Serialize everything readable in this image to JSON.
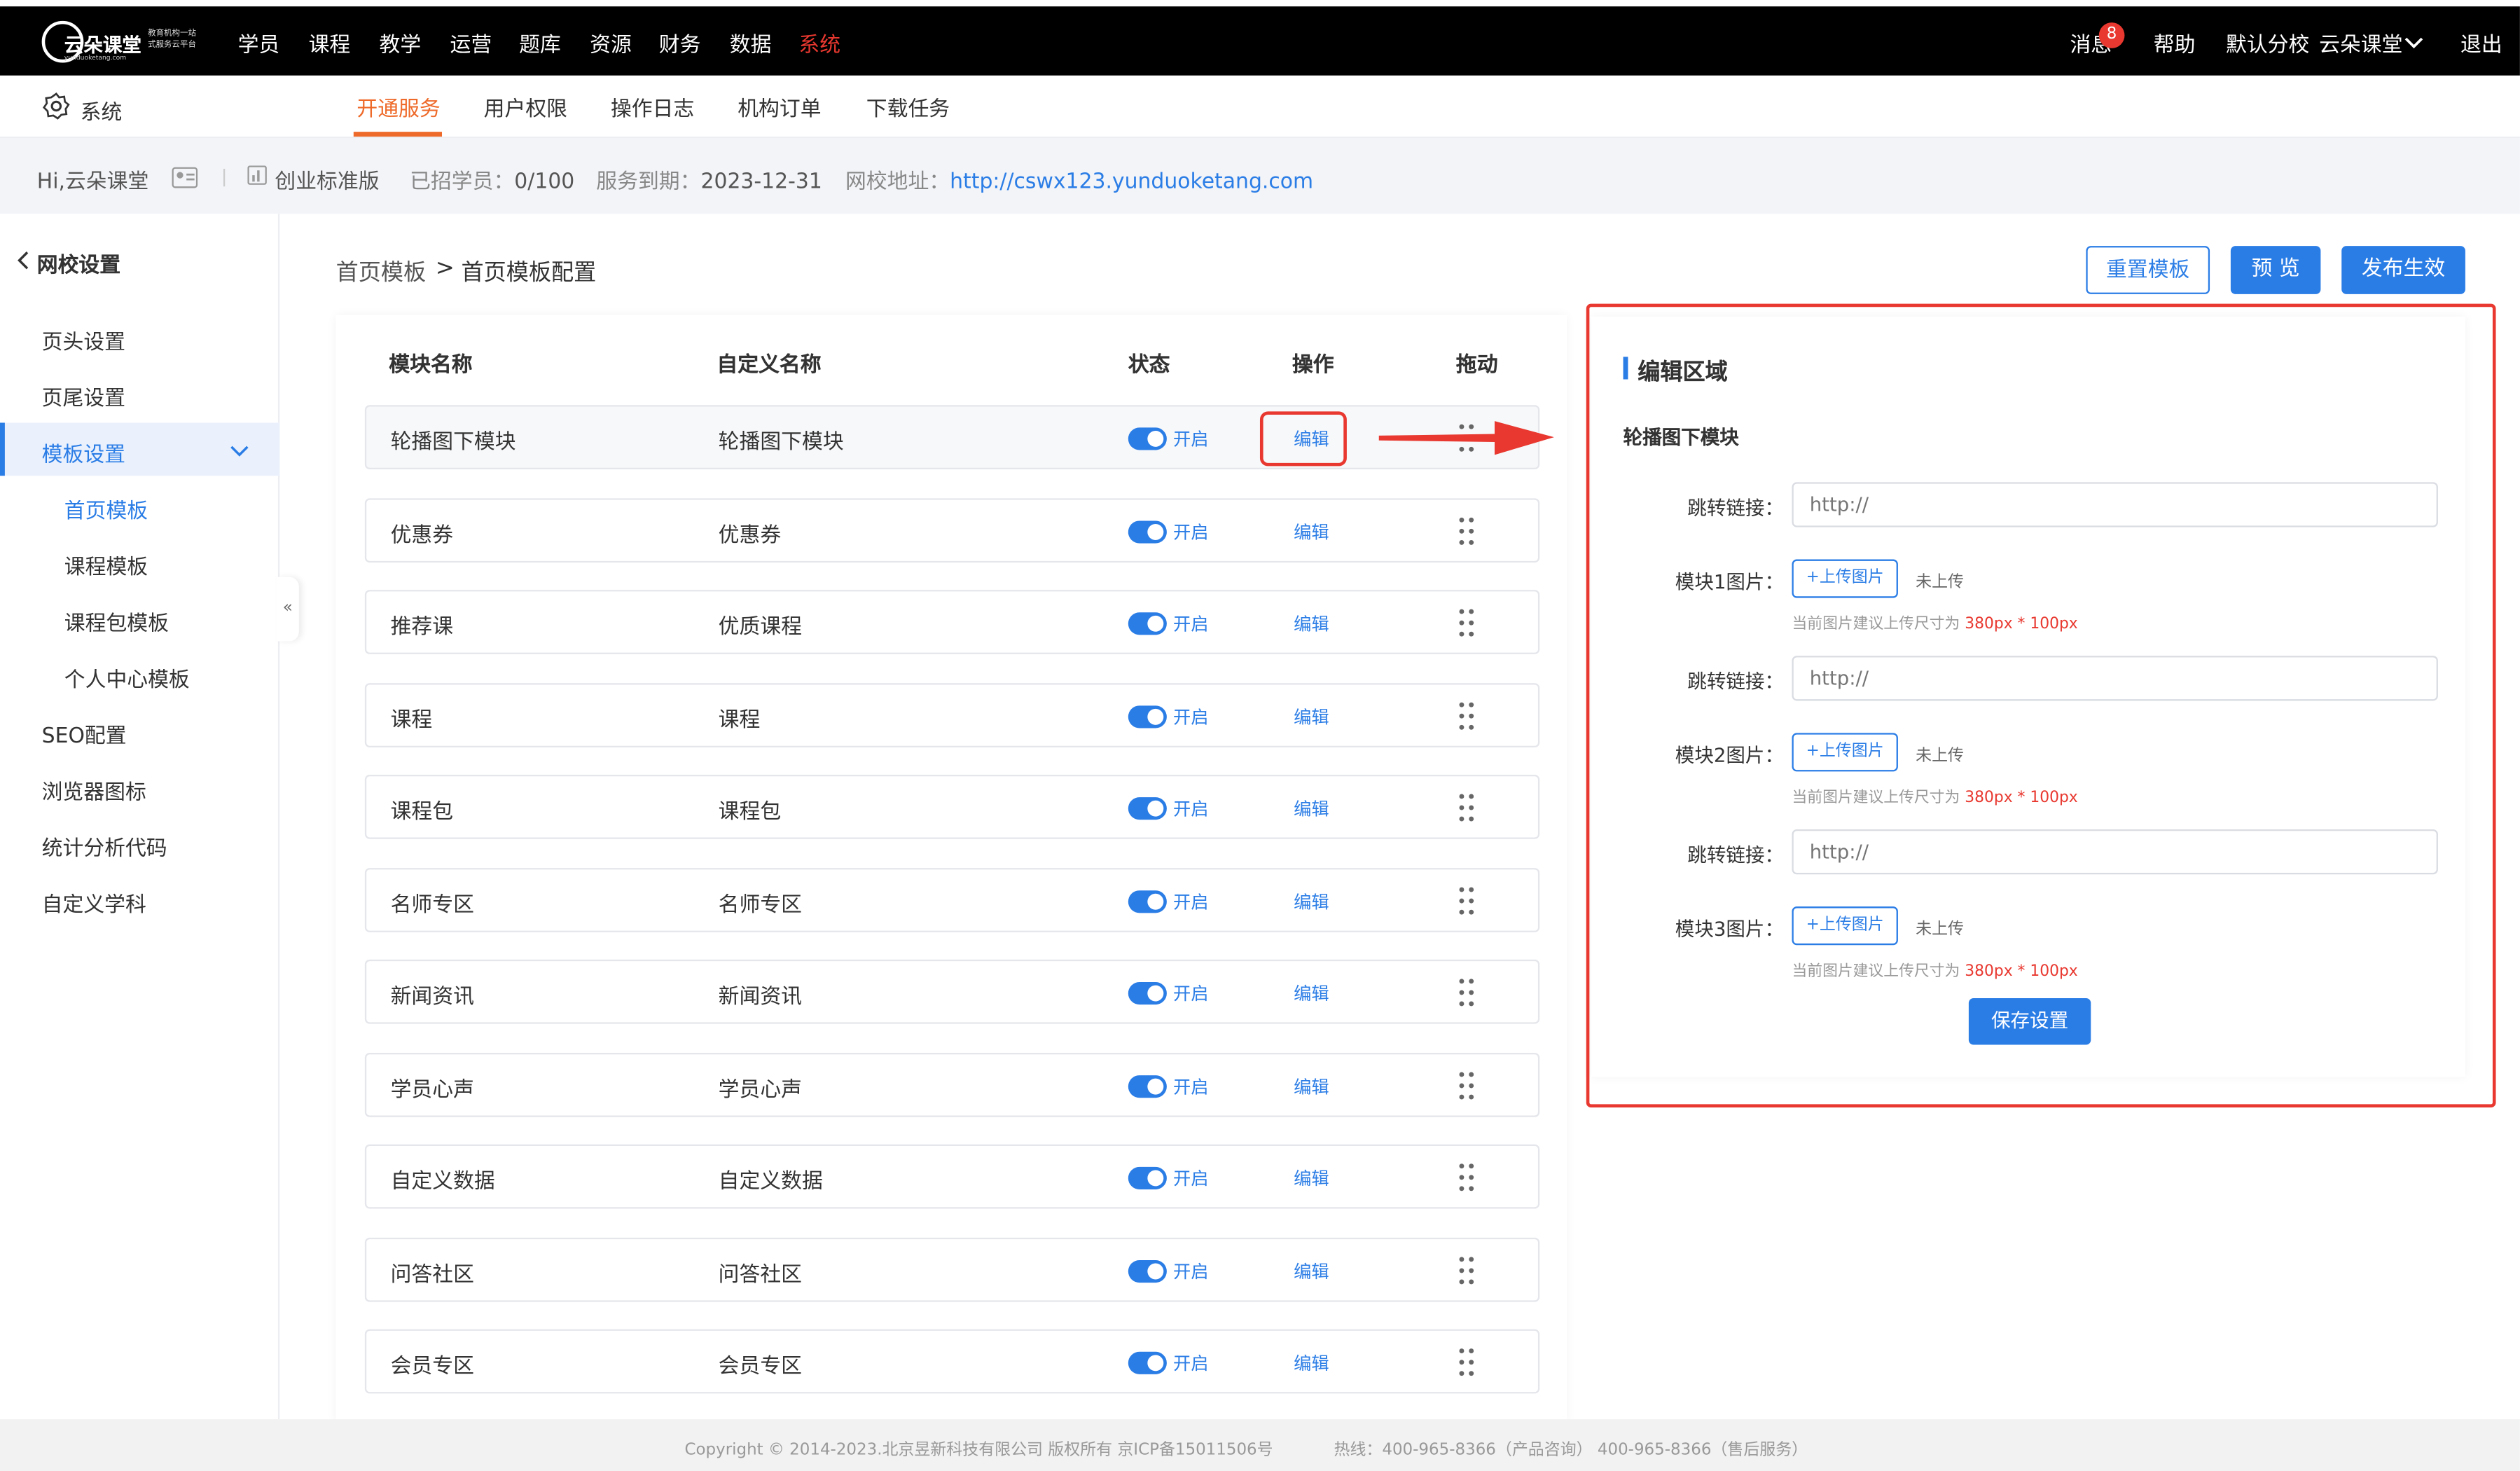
{
  "topnav": {
    "logo_text": "云朵课堂",
    "logo_sub_1": "教育机构一站",
    "logo_sub_2": "式服务云平台",
    "logo_url": "yunduoketang.com",
    "items": [
      "学员",
      "课程",
      "教学",
      "运营",
      "题库",
      "资源",
      "财务",
      "数据",
      "系统"
    ],
    "active_item": "系统",
    "right": {
      "messages": "消息",
      "message_count": "8",
      "help": "帮助",
      "branch": "默认分校",
      "user": "云朵课堂",
      "logout": "退出"
    }
  },
  "subbar": {
    "section": "系统",
    "tabs": [
      "开通服务",
      "用户权限",
      "操作日志",
      "机构订单",
      "下载任务"
    ],
    "active_tab": "开通服务"
  },
  "infobar": {
    "greeting": "Hi,云朵课堂",
    "edition": "创业标准版",
    "students_label": "已招学员：",
    "students_value": "0/100",
    "expiry_label": "服务到期：",
    "expiry_value": "2023-12-31",
    "url_label": "网校地址：",
    "url_value": "http://cswx123.yunduoketang.com"
  },
  "sidebar": {
    "back_label": "网校设置",
    "items": [
      "页头设置",
      "页尾设置",
      "模板设置",
      "首页模板",
      "课程模板",
      "课程包模板",
      "个人中心模板",
      "SEO配置",
      "浏览器图标",
      "统计分析代码",
      "自定义学科"
    ],
    "collapse_icon": "«"
  },
  "breadcrumb": {
    "parent": "首页模板",
    "separator": ">",
    "current": "首页模板配置"
  },
  "actions": {
    "reset": "重置模板",
    "preview": "预 览",
    "publish": "发布生效"
  },
  "table": {
    "headers": [
      "模块名称",
      "自定义名称",
      "状态",
      "操作",
      "拖动"
    ],
    "rows": [
      {
        "name": "轮播图下模块",
        "custom": "轮播图下模块",
        "status": "开启",
        "action": "编辑"
      },
      {
        "name": "优惠券",
        "custom": "优惠券",
        "status": "开启",
        "action": "编辑"
      },
      {
        "name": "推荐课",
        "custom": "优质课程",
        "status": "开启",
        "action": "编辑"
      },
      {
        "name": "课程",
        "custom": "课程",
        "status": "开启",
        "action": "编辑"
      },
      {
        "name": "课程包",
        "custom": "课程包",
        "status": "开启",
        "action": "编辑"
      },
      {
        "name": "名师专区",
        "custom": "名师专区",
        "status": "开启",
        "action": "编辑"
      },
      {
        "name": "新闻资讯",
        "custom": "新闻资讯",
        "status": "开启",
        "action": "编辑"
      },
      {
        "name": "学员心声",
        "custom": "学员心声",
        "status": "开启",
        "action": "编辑"
      },
      {
        "name": "自定义数据",
        "custom": "自定义数据",
        "status": "开启",
        "action": "编辑"
      },
      {
        "name": "问答社区",
        "custom": "问答社区",
        "status": "开启",
        "action": "编辑"
      },
      {
        "name": "会员专区",
        "custom": "会员专区",
        "status": "开启",
        "action": "编辑"
      }
    ]
  },
  "edit_panel": {
    "title": "编辑区域",
    "module_name": "轮播图下模块",
    "link_label": "跳转链接：",
    "link_placeholder": "http://",
    "image_labels": [
      "模块1图片：",
      "模块2图片：",
      "模块3图片："
    ],
    "upload_label": "+上传图片",
    "upload_state": "未上传",
    "hint_prefix": "当前图片建议上传尺寸为",
    "hint_size": "380px * 100px",
    "save": "保存设置"
  },
  "footer": {
    "copyright": "Copyright © 2014-2023.北京昱新科技有限公司 版权所有 京ICP备15011506号",
    "hotline": "热线：400-965-8366（产品咨询） 400-965-8366（售后服务）"
  },
  "colors": {
    "accent": "#2b7de6",
    "tab_active": "#ee6a2a",
    "annotation_red": "#e8382f",
    "nav_bg": "#000000"
  }
}
